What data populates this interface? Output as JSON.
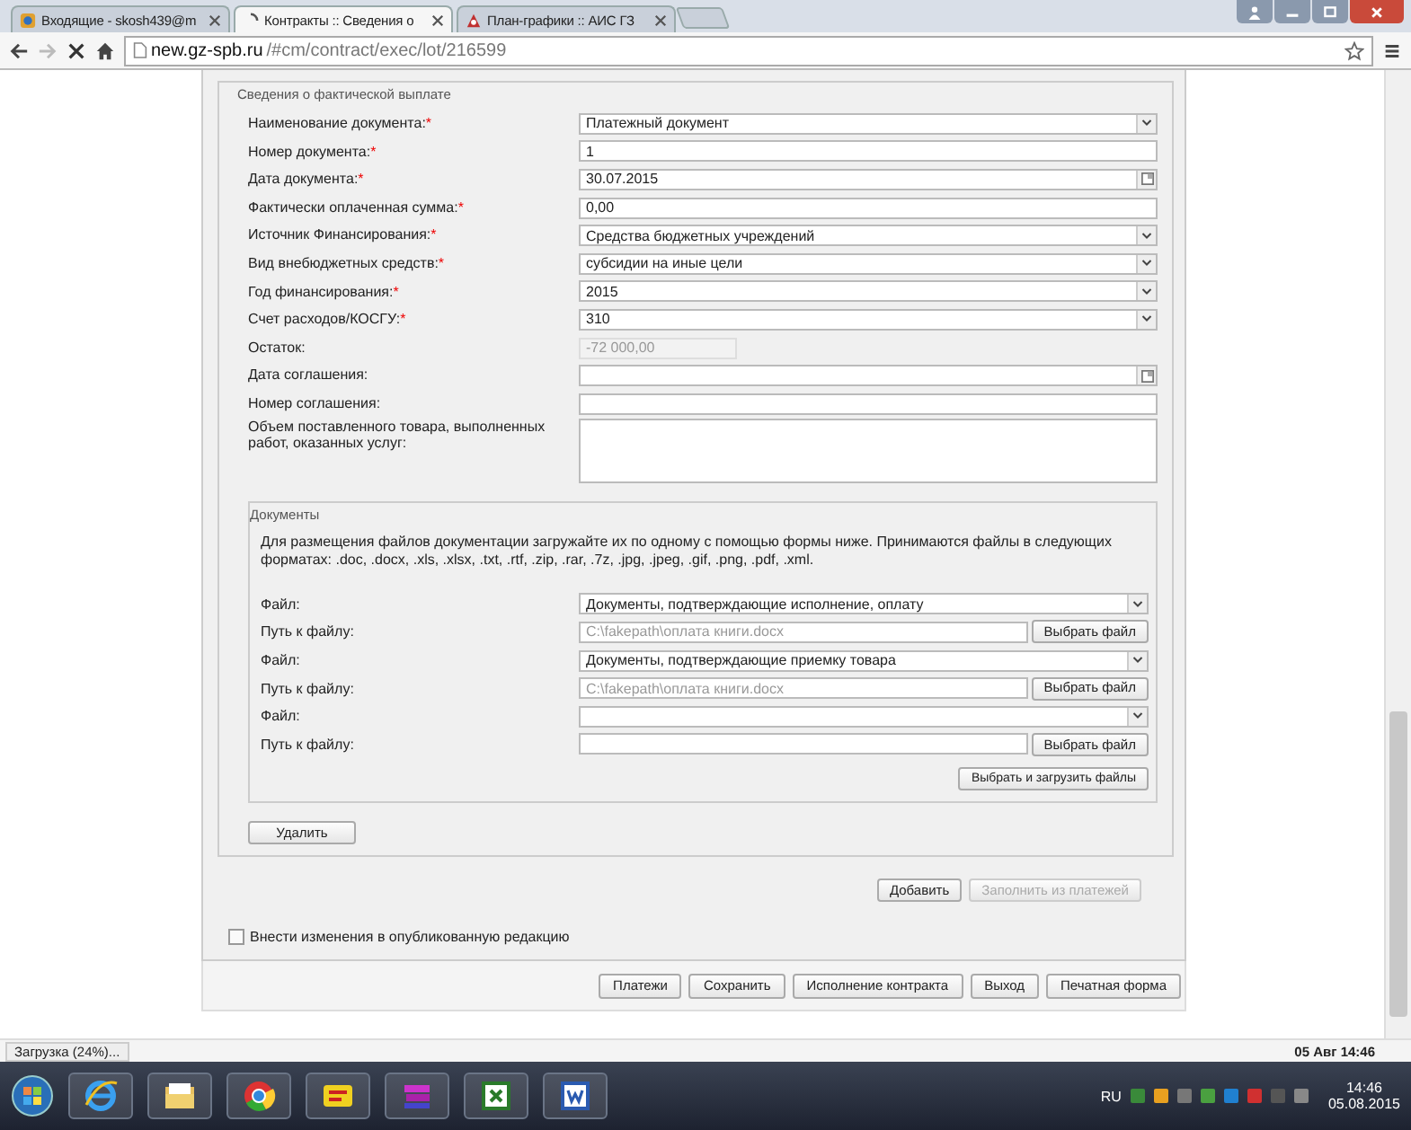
{
  "browser": {
    "tabs": [
      {
        "label": "Входящие - skosh439@m",
        "selected": false,
        "kind": "mail"
      },
      {
        "label": "Контракты :: Сведения о",
        "selected": true,
        "kind": "loading"
      },
      {
        "label": "План-графики :: АИС ГЗ",
        "selected": false,
        "kind": "site"
      }
    ],
    "url_host": "new.gz-spb.ru",
    "url_path": "/#cm/contract/exec/lot/216599"
  },
  "section_title": "Сведения о фактической выплате",
  "fields": [
    {
      "label": "Наименование документа:",
      "required_mark": "*",
      "kind": "select",
      "value": "Платежный документ"
    },
    {
      "label": "Номер документа:",
      "required_mark": "*",
      "kind": "text",
      "value": "1"
    },
    {
      "label": "Дата документа:",
      "required_mark": "*",
      "kind": "date",
      "value": "30.07.2015"
    },
    {
      "label": "Фактически оплаченная сумма:",
      "required_mark": "*",
      "kind": "text",
      "value": "0,00"
    },
    {
      "label": "Источник Финансирования:",
      "required_mark": "*",
      "kind": "select",
      "value": "Средства бюджетных учреждений"
    },
    {
      "label": "Вид внебюджетных средств:",
      "required_mark": "*",
      "kind": "select",
      "value": "субсидии на иные цели"
    },
    {
      "label": "Год финансирования:",
      "required_mark": "*",
      "kind": "select",
      "value": "2015"
    },
    {
      "label": "Счет расходов/КОСГУ:",
      "required_mark": "*",
      "kind": "select",
      "value": "310"
    },
    {
      "label": "Остаток:",
      "kind": "readonly",
      "value": "-72 000,00"
    },
    {
      "label": "Дата соглашения:",
      "kind": "date"
    },
    {
      "label": "Номер соглашения:",
      "kind": "text"
    },
    {
      "label": "Объем поставленного товара, выполненных работ, оказанных услуг:",
      "kind": "textarea"
    }
  ],
  "documents": {
    "title": "Документы",
    "hint": "Для размещения файлов документации загружайте их по одному с помощью формы ниже. Принимаются файлы в следующих форматах: .doc, .docx, .xls, .xlsx, .txt, .rtf, .zip, .rar, .7z, .jpg, .jpeg, .gif, .png, .pdf, .xml.",
    "rows": [
      {
        "kind": "select",
        "label": "Файл:",
        "value": "Документы, подтверждающие исполнение, оплату"
      },
      {
        "kind": "file",
        "label": "Путь к файлу:",
        "value": "C:\\fakepath\\оплата книги.docx",
        "button": "Выбрать файл"
      },
      {
        "kind": "select",
        "label": "Файл:",
        "value": "Документы, подтверждающие приемку товара"
      },
      {
        "kind": "file",
        "label": "Путь к файлу:",
        "value": "C:\\fakepath\\оплата книги.docx",
        "button": "Выбрать файл"
      },
      {
        "kind": "select",
        "label": "Файл:"
      },
      {
        "kind": "file",
        "label": "Путь к файлу:",
        "button": "Выбрать файл"
      }
    ],
    "upload_button": "Выбрать и загрузить файлы"
  },
  "delete_button": "Удалить",
  "actions": [
    {
      "label": "Добавить",
      "disabled": false
    },
    {
      "label": "Заполнить из платежей",
      "disabled": true
    }
  ],
  "publish_checkbox": {
    "label": "Внести изменения в опубликованную редакцию",
    "checked": false
  },
  "footer_buttons": [
    "Платежи",
    "Сохранить",
    "Исполнение контракта",
    "Выход",
    "Печатная форма"
  ],
  "status_bar": {
    "text": "Загрузка (24%)...",
    "datetime": "05 Авг 14:46"
  },
  "taskbar": {
    "language": "RU",
    "time": "14:46",
    "date": "05.08.2015"
  }
}
